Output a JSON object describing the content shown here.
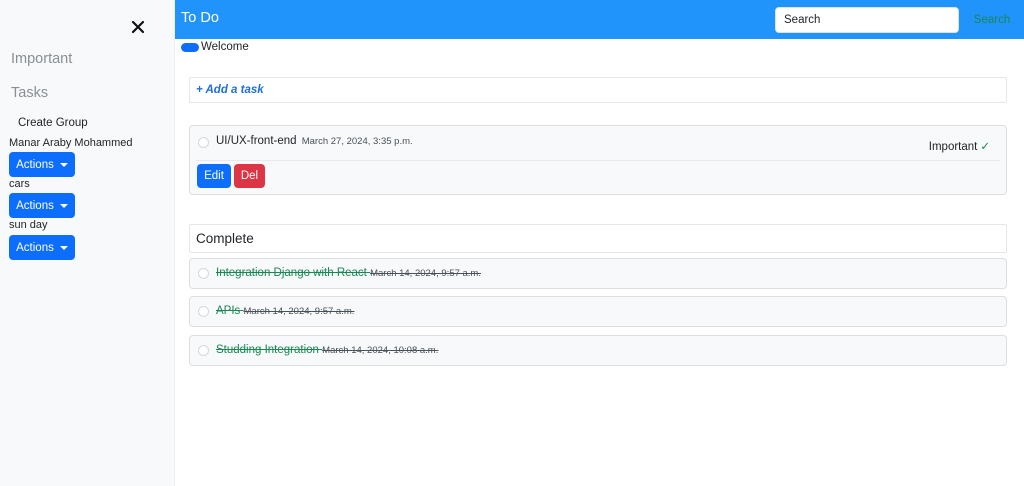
{
  "sidebar": {
    "important_label": "Important",
    "tasks_label": "Tasks",
    "create_group_label": "Create Group",
    "groups": [
      {
        "name": "Manar Araby Mohammed",
        "actions_label": "Actions"
      },
      {
        "name": "cars",
        "actions_label": "Actions"
      },
      {
        "name": "sun day",
        "actions_label": "Actions"
      }
    ]
  },
  "navbar": {
    "brand": "To Do",
    "search_placeholder": "Search",
    "search_button": "Search"
  },
  "welcome": "Welcome",
  "add_task_label": "+ Add a task",
  "tasks": [
    {
      "title": "UI/UX-front-end",
      "date": "March 27, 2024, 3:35 p.m.",
      "important_label": "Important",
      "check": "✓",
      "edit_label": "Edit",
      "delete_label": "Del"
    }
  ],
  "complete": {
    "title": "Complete",
    "items": [
      {
        "title": "Integration Django with React",
        "date": "March 14, 2024, 9:57 a.m."
      },
      {
        "title": "APIs",
        "date": "March 14, 2024, 9:57 a.m."
      },
      {
        "title": "Studding Integration",
        "date": "March 14, 2024, 10:08 a.m."
      }
    ]
  },
  "colors": {
    "primary": "#0d6efd",
    "navbar": "#2094fb",
    "danger": "#dc3545",
    "success": "#198754"
  }
}
